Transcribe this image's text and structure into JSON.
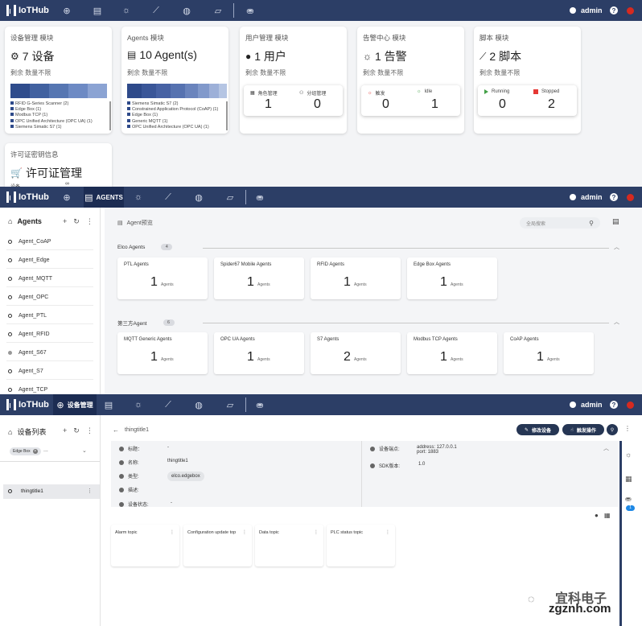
{
  "brand": "IoTHub",
  "user": "admin",
  "panel1": {
    "cards": [
      {
        "title": "设备管理 模块",
        "value": "7 设备",
        "remain": "剩余 数量不限",
        "icon": "chip-icon"
      },
      {
        "title": "Agents 模块",
        "value": "10 Agent(s)",
        "remain": "剩余 数量不限",
        "icon": "server-icon"
      },
      {
        "title": "用户管理 模块",
        "value": "1 用户",
        "remain": "剩余 数量不限",
        "icon": "person-icon"
      },
      {
        "title": "告警中心 模块",
        "value": "1 告警",
        "remain": "剩余 数量不限",
        "icon": "alarm-icon"
      },
      {
        "title": "脚本 模块",
        "value": "2 脚本",
        "remain": "剩余 数量不限",
        "icon": "trend-icon"
      }
    ],
    "device_legend": [
      "RFID G-Series Scanner (2)",
      "Edge Box (1)",
      "Modbus TCP (1)",
      "OPC Unified Architecture (OPC UA) (1)",
      "Siemens Simatic S7 (1)"
    ],
    "agent_legend": [
      "Siemens Simatic S7 (2)",
      "Constrained Application Protocol (CoAP) (1)",
      "Edge Box (1)",
      "Generic MQTT (1)",
      "OPC Unified Architecture (OPC UA) (1)"
    ],
    "user_sub": [
      {
        "label": "角色管理",
        "value": "1"
      },
      {
        "label": "分组管理",
        "value": "0"
      }
    ],
    "alarm_sub": [
      {
        "label": "触发",
        "value": "0"
      },
      {
        "label": "Idle",
        "value": "1"
      }
    ],
    "script_sub": [
      {
        "label": "Running",
        "value": "0"
      },
      {
        "label": "Stopped",
        "value": "2"
      }
    ],
    "license": {
      "title": "许可证密钥信息",
      "value": "许可证管理",
      "cut1": "设备",
      "cut2": "∞"
    }
  },
  "panel2": {
    "nav_active": "AGENTS",
    "side_title": "Agents",
    "side_items": [
      "Agent_CoAP",
      "Agent_Edge",
      "Agent_MQTT",
      "Agent_OPC",
      "Agent_PTL",
      "Agent_RFID",
      "Agent_S67",
      "Agent_S7",
      "Agent_TCP"
    ],
    "crumb": "Agent预览",
    "search_placeholder": "全局搜索",
    "group1": {
      "name": "Elco Agents",
      "count": "4",
      "cards": [
        {
          "title": "PTL Agents",
          "num": "1"
        },
        {
          "title": "Spider67 Mobile Agents",
          "num": "1"
        },
        {
          "title": "RFID Agents",
          "num": "1"
        },
        {
          "title": "Edge Box Agents",
          "num": "1"
        }
      ]
    },
    "group2": {
      "name": "第三方Agent",
      "count": "6",
      "cards": [
        {
          "title": "MQTT Generic Agents",
          "num": "1"
        },
        {
          "title": "OPC UA Agents",
          "num": "1"
        },
        {
          "title": "S7 Agents",
          "num": "2"
        },
        {
          "title": "Modbus TCP Agents",
          "num": "1"
        },
        {
          "title": "CoAP Agents",
          "num": "1"
        }
      ]
    },
    "unit": "Agents"
  },
  "panel3": {
    "nav_active": "设备管理",
    "side_title": "设备列表",
    "filter_chip": "Edge Box",
    "filter_more": "...",
    "side_item": "thingtitle1",
    "crumb": "thingtitle1",
    "btn_edit": "修改设备",
    "btn_trigger": "触发操作",
    "fields": [
      {
        "label": "标题：",
        "value": "-"
      },
      {
        "label": "名称:",
        "value": "thingtitle1"
      },
      {
        "label": "类型:",
        "value": "elco.edgebox"
      },
      {
        "label": "描述:",
        "value": ""
      },
      {
        "label": "设备状态:",
        "value": "-"
      }
    ],
    "addr_label": "设备端点:",
    "addr": [
      "address: 127.0.0.1",
      "port: 1883"
    ],
    "sdk_label": "SDK版本:",
    "sdk": "1.0",
    "topics": [
      "Alarm topic",
      "Configuration update top",
      "Data topic",
      "PLC status topic"
    ],
    "badge": "1"
  },
  "watermark": {
    "line1": "宜科电子",
    "line2": "zgznh.com"
  }
}
